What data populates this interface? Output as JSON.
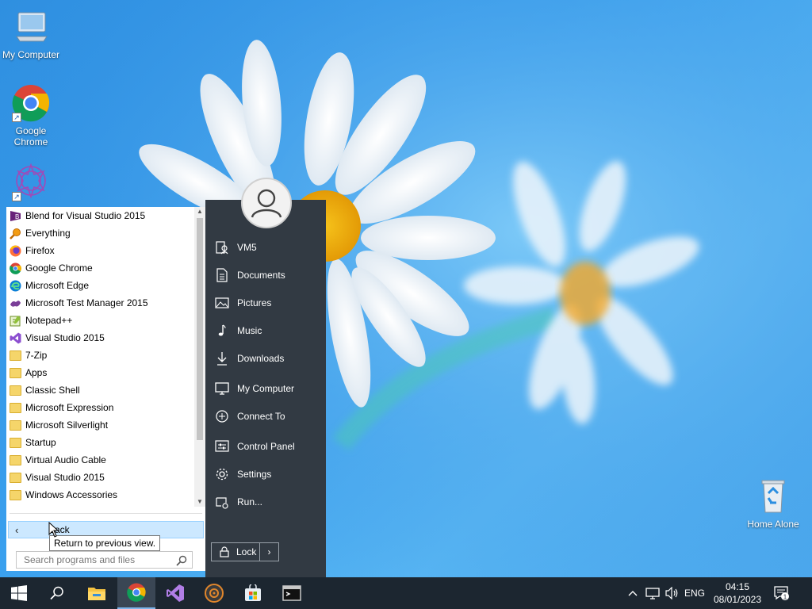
{
  "desktop": {
    "icons": [
      {
        "label": "My Computer",
        "icon": "computer-icon"
      },
      {
        "label": "Google\nChrome",
        "icon": "chrome-icon"
      },
      {
        "label": "",
        "icon": "purple-mandala-icon"
      },
      {
        "label": "Home Alone",
        "icon": "recycle-bin-icon"
      }
    ]
  },
  "start_menu": {
    "programs": [
      {
        "label": "Blend for Visual Studio 2015",
        "icon": "blend-icon"
      },
      {
        "label": "Everything",
        "icon": "everything-search-icon"
      },
      {
        "label": "Firefox",
        "icon": "firefox-icon"
      },
      {
        "label": "Google Chrome",
        "icon": "chrome-icon"
      },
      {
        "label": "Microsoft Edge",
        "icon": "edge-icon"
      },
      {
        "label": "Microsoft Test Manager 2015",
        "icon": "test-manager-icon"
      },
      {
        "label": "Notepad++",
        "icon": "notepadpp-icon"
      },
      {
        "label": "Visual Studio 2015",
        "icon": "visual-studio-icon"
      },
      {
        "label": "7-Zip",
        "icon": "folder-icon"
      },
      {
        "label": "Apps",
        "icon": "folder-icon"
      },
      {
        "label": "Classic Shell",
        "icon": "folder-icon"
      },
      {
        "label": "Microsoft Expression",
        "icon": "folder-icon"
      },
      {
        "label": "Microsoft Silverlight",
        "icon": "folder-icon"
      },
      {
        "label": "Startup",
        "icon": "folder-icon"
      },
      {
        "label": "Virtual Audio Cable",
        "icon": "folder-icon"
      },
      {
        "label": "Visual Studio 2015",
        "icon": "folder-icon"
      },
      {
        "label": "Windows Accessories",
        "icon": "folder-icon"
      }
    ],
    "back_label": "Back",
    "tooltip": "Return to previous view.",
    "search_placeholder": "Search programs and files",
    "places": [
      {
        "label": "VM5",
        "icon": "user-folder-icon"
      },
      {
        "label": "Documents",
        "icon": "document-icon"
      },
      {
        "label": "Pictures",
        "icon": "pictures-icon"
      },
      {
        "label": "Music",
        "icon": "music-note-icon"
      },
      {
        "label": "Downloads",
        "icon": "download-arrow-icon"
      },
      {
        "label": "My Computer",
        "icon": "monitor-icon"
      },
      {
        "label": "Connect To",
        "icon": "connect-icon"
      },
      {
        "label": "Control Panel",
        "icon": "control-panel-icon"
      },
      {
        "label": "Settings",
        "icon": "gear-icon"
      },
      {
        "label": "Run...",
        "icon": "run-icon"
      }
    ],
    "lock_label": "Lock"
  },
  "taskbar": {
    "apps": [
      "start-windows-icon",
      "search-icon",
      "file-explorer-icon",
      "chrome-icon",
      "visual-studio-icon",
      "media-player-icon",
      "store-icon",
      "terminal-icon"
    ],
    "language": "ENG",
    "time": "04:15",
    "date": "08/01/2023",
    "notification_count": "1"
  },
  "colors": {
    "places_bg": "#323a43",
    "taskbar_bg": "#1c2630",
    "hover_bg": "#cce8ff",
    "desktop_blue": "#3aa0ee"
  }
}
